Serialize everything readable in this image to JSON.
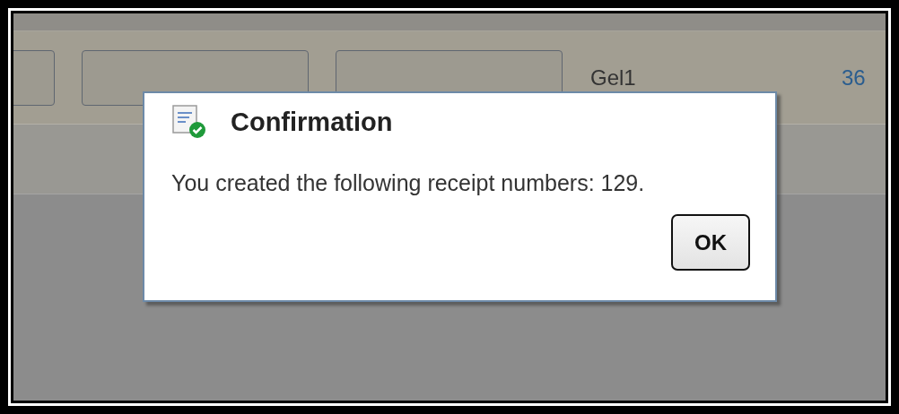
{
  "background": {
    "row": [
      {
        "kind": "field"
      },
      {
        "kind": "field"
      },
      {
        "kind": "field"
      },
      {
        "kind": "text",
        "text": "Gel1"
      },
      {
        "kind": "link",
        "text": "36"
      }
    ]
  },
  "dialog": {
    "title": "Confirmation",
    "message": "You created the following receipt numbers: 129.",
    "buttons": [
      {
        "label": "OK",
        "default": true
      }
    ]
  }
}
